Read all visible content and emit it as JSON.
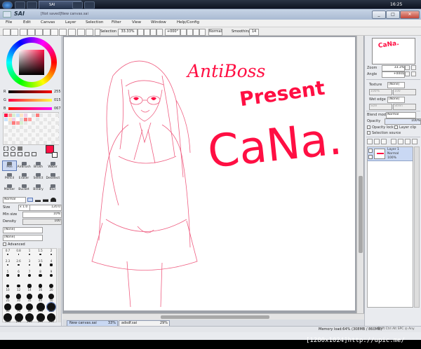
{
  "taskbar": {
    "task_label": "SAI",
    "clock": "16:25"
  },
  "window": {
    "app_title": "SAI",
    "file_title": "[Not saved]New canvas.sai",
    "controls": [
      "_",
      "□",
      "✕"
    ]
  },
  "menubar": {
    "items": [
      "File",
      "Edit",
      "Canvas",
      "Layer",
      "Selection",
      "Filter",
      "View",
      "Window",
      "Help/Config"
    ]
  },
  "toolbar": {
    "selection_label": "Selection",
    "zoom_value": "33.33%",
    "angle_value": "+000°",
    "blend_mode": "Normal",
    "smoothing_label": "Smoothing",
    "smoothing_value": "14"
  },
  "color_panel": {
    "r_label": "R",
    "r_value": "255",
    "g_label": "G",
    "g_value": "015",
    "b_label": "B",
    "b_value": "067",
    "accent": "#ff0f43"
  },
  "tools": {
    "row1": [
      "Pen",
      "AirBrush",
      "Brush",
      "Water"
    ],
    "row2": [
      "Pencil",
      "Eraser",
      "Select",
      "Deselect"
    ],
    "row3": [
      "Marker",
      "Bucket",
      "Binary",
      "Blur"
    ]
  },
  "brush_settings": {
    "mode": "Normal",
    "size_label": "Size",
    "size_mult": "x 1.0",
    "size_value": "120.0",
    "min_size_label": "Min size",
    "min_size_value": "10%",
    "density_label": "Density",
    "density_value": "100",
    "shape_value": "[None]",
    "texture_value": "[None]",
    "advanced_label": "Advanced",
    "brush_sizes": [
      "0.7",
      "0.8",
      "1",
      "1.5",
      "2",
      "2.3",
      "2.6",
      "3",
      "3.5",
      "4",
      "5",
      "6",
      "7",
      "8",
      "9",
      "10",
      "12",
      "14",
      "16",
      "20",
      "25",
      "30",
      "35",
      "40",
      "50",
      "60",
      "70",
      "80",
      "100",
      "120",
      "150",
      "200",
      "250",
      "300",
      "350"
    ]
  },
  "navigator": {
    "zoom_label": "Zoom",
    "zoom_value": "33.3%",
    "angle_label": "Angle",
    "angle_value": "+000$"
  },
  "layer_panel": {
    "texture_label": "Texture",
    "texture_value": "[None]",
    "texture_scale": "100%",
    "texture_strength": "100",
    "wet_edge_label": "Wet edge",
    "wet_edge_value": "[None]",
    "wet_edge_size": "Size",
    "wet_edge_strength": "Stren",
    "blend_mode_label": "Blend mode",
    "blend_mode_value": "Normal",
    "opacity_label": "Opacity",
    "opacity_value": "100%",
    "opacity_lock_label": "Opacity lock",
    "layer_clip_label": "Layer clip",
    "selection_source_label": "Selection source",
    "layers": [
      {
        "name": "Layer 1",
        "mode": "Normal",
        "opacity": "100%"
      }
    ]
  },
  "document_tabs": [
    {
      "name": "New canvas.sai",
      "zoom": "33%"
    },
    {
      "name": "adsdf.sai",
      "zoom": "29%"
    }
  ],
  "statusbar": {
    "memory": "Memory load:64% (308MB / 860MB)",
    "keys": "Shift Ctrl Alt SPC ◎ Any"
  },
  "canvas_text": {
    "line1": "AntiBoss",
    "line2": "Present",
    "line3": "CaNa."
  },
  "watermark": "[1280x1024]http://upic.me/"
}
